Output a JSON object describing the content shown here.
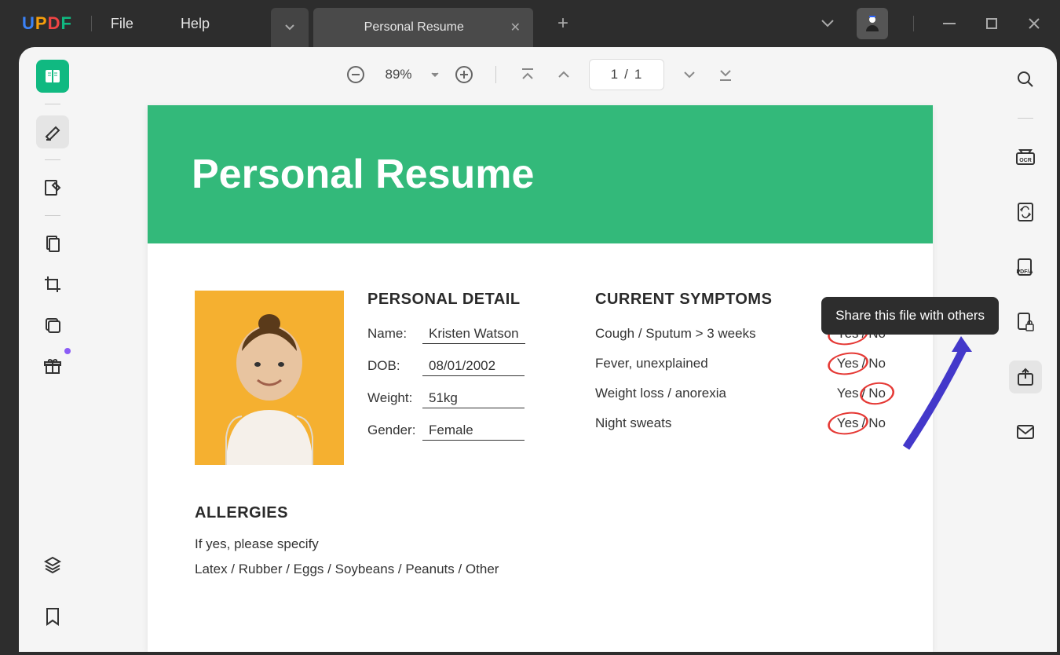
{
  "logo": {
    "u": "U",
    "p": "P",
    "d": "D",
    "f": "F"
  },
  "menu": {
    "file": "File",
    "help": "Help"
  },
  "tab": {
    "title": "Personal Resume"
  },
  "zoom": {
    "level": "89%"
  },
  "pages": {
    "current": "1",
    "sep": "/",
    "total": "1"
  },
  "tooltip": "Share this file with others",
  "doc": {
    "title": "Personal Resume",
    "personal_detail": {
      "heading": "PERSONAL DETAIL",
      "name_label": "Name:",
      "name_value": "Kristen Watson",
      "dob_label": "DOB:",
      "dob_value": "08/01/2002",
      "weight_label": "Weight:",
      "weight_value": "51kg",
      "gender_label": "Gender:",
      "gender_value": "Female"
    },
    "symptoms": {
      "heading": "CURRENT SYMPTOMS",
      "items": [
        {
          "text": "Cough / Sputum > 3 weeks",
          "yes": "Yes",
          "sep": "/",
          "no": "No",
          "circled": "yes"
        },
        {
          "text": "Fever, unexplained",
          "yes": "Yes",
          "sep": "/",
          "no": "No",
          "circled": "yes"
        },
        {
          "text": "Weight loss / anorexia",
          "yes": "Yes",
          "sep": "/",
          "no": "No",
          "circled": "no"
        },
        {
          "text": "Night sweats",
          "yes": "Yes",
          "sep": "/",
          "no": "No",
          "circled": "yes"
        }
      ]
    },
    "allergies": {
      "heading": "ALLERGIES",
      "line1": "If yes, please specify",
      "line2": "Latex / Rubber / Eggs / Soybeans / Peanuts / Other"
    }
  }
}
